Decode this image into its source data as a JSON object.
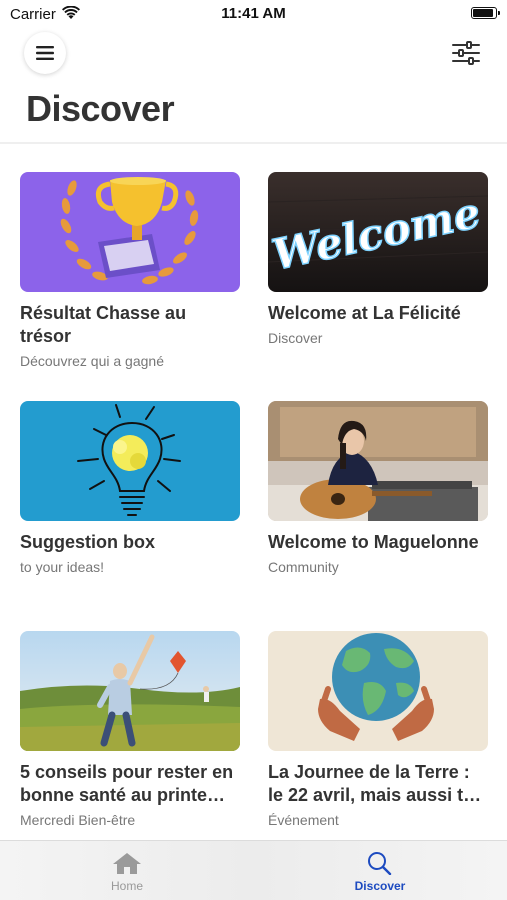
{
  "status_bar": {
    "carrier": "Carrier",
    "time": "11:41 AM"
  },
  "header": {
    "title": "Discover"
  },
  "cards": [
    {
      "title": "Résultat Chasse au trésor",
      "subtitle": "Découvrez qui a gagné",
      "image": "trophy-image"
    },
    {
      "title": "Welcome at La Félicité",
      "subtitle": "Discover",
      "image": "neon-welcome-image",
      "image_text": "Welcome"
    },
    {
      "title": "Suggestion box",
      "subtitle": "to your ideas!",
      "image": "lightbulb-image"
    },
    {
      "title": "Welcome to Maguelonne",
      "subtitle": "Community",
      "image": "guitar-person-image"
    },
    {
      "title": "5 conseils pour rester en bonne santé au printe…",
      "subtitle": "Mercredi Bien-être",
      "image": "kite-field-image"
    },
    {
      "title": "La Journee de la Terre : le 22 avril, mais aussi t…",
      "subtitle": "Événement",
      "image": "earth-hands-image"
    }
  ],
  "tab_bar": {
    "tabs": [
      {
        "label": "Home",
        "icon": "home-icon",
        "active": false
      },
      {
        "label": "Discover",
        "icon": "search-icon",
        "active": true
      }
    ]
  },
  "colors": {
    "accent": "#1d4bc0",
    "inactive": "#999999",
    "trophy_bg": "#8c63ea",
    "lightbulb_bg": "#239ccf",
    "earth_bg": "#efe6d6"
  }
}
